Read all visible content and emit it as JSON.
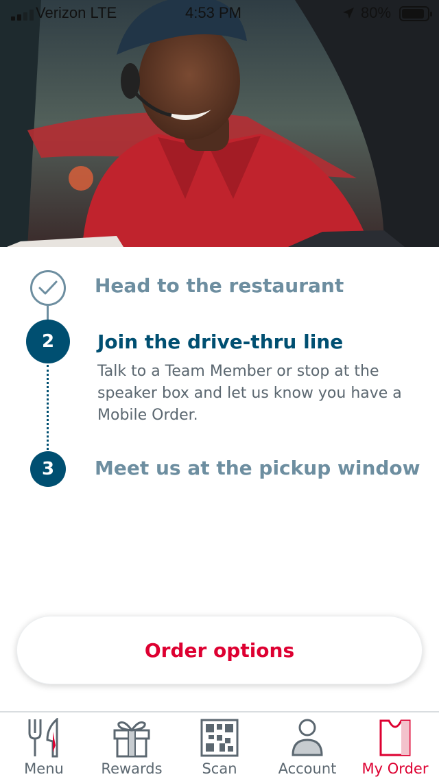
{
  "status_bar": {
    "carrier": "Verizon LTE",
    "time": "4:53 PM",
    "battery_percent": "80%"
  },
  "hero": {
    "icon": "drive-thru-photo"
  },
  "steps": [
    {
      "number": "",
      "title": "Head to the restaurant",
      "state": "completed",
      "icon": "check-icon"
    },
    {
      "number": "2",
      "title": "Join the drive-thru line",
      "state": "active",
      "description": "Talk to a Team Member or stop at the speaker box and let us know you have a Mobile Order."
    },
    {
      "number": "3",
      "title": "Meet us at the pickup window",
      "state": "pending"
    }
  ],
  "order_options": {
    "label": "Order options"
  },
  "tabbar": {
    "items": [
      {
        "label": "Menu",
        "icon": "fork-knife-icon",
        "active": false
      },
      {
        "label": "Rewards",
        "icon": "gift-icon",
        "active": false
      },
      {
        "label": "Scan",
        "icon": "qr-code-icon",
        "active": false
      },
      {
        "label": "Account",
        "icon": "person-icon",
        "active": false
      },
      {
        "label": "My Order",
        "icon": "bag-icon",
        "active": true
      }
    ]
  },
  "colors": {
    "navy": "#004f71",
    "muted_blue": "#6d8ea0",
    "brand_red": "#dd0031",
    "gray_text": "#5b6770"
  }
}
